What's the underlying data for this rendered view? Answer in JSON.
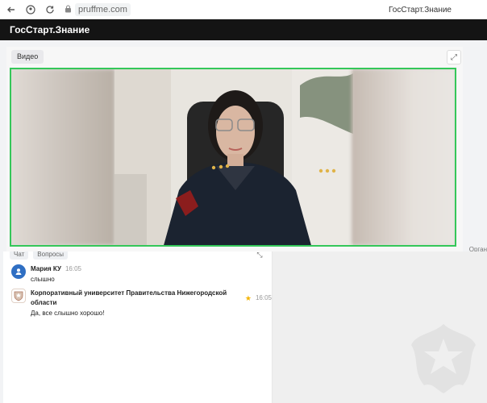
{
  "browser": {
    "url": "pruffme.com",
    "tab_title": "ГосСтарт.Знание"
  },
  "app": {
    "title": "ГосСтарт.Знание"
  },
  "video": {
    "tab_label": "Видео",
    "hidden_label": "Орган"
  },
  "chat": {
    "tabs": [
      "Чат",
      "Вопросы"
    ],
    "messages": [
      {
        "name": "Мария КУ",
        "time": "16:05",
        "text": "слышно",
        "avatar_icon": "user-avatar-icon",
        "avatar_color": "#2f6fc3"
      },
      {
        "name": "Корпоративный университет Правительства Нижегородской области",
        "time": "16:05",
        "text": "Да, все слышно хорошо!",
        "avatar_icon": "crest-avatar-icon",
        "badge_icon": "star-icon"
      }
    ]
  },
  "colors": {
    "header_bg": "#141414",
    "video_border": "#34c759",
    "accent_blue": "#2f6fc3",
    "star": "#f4b400"
  }
}
